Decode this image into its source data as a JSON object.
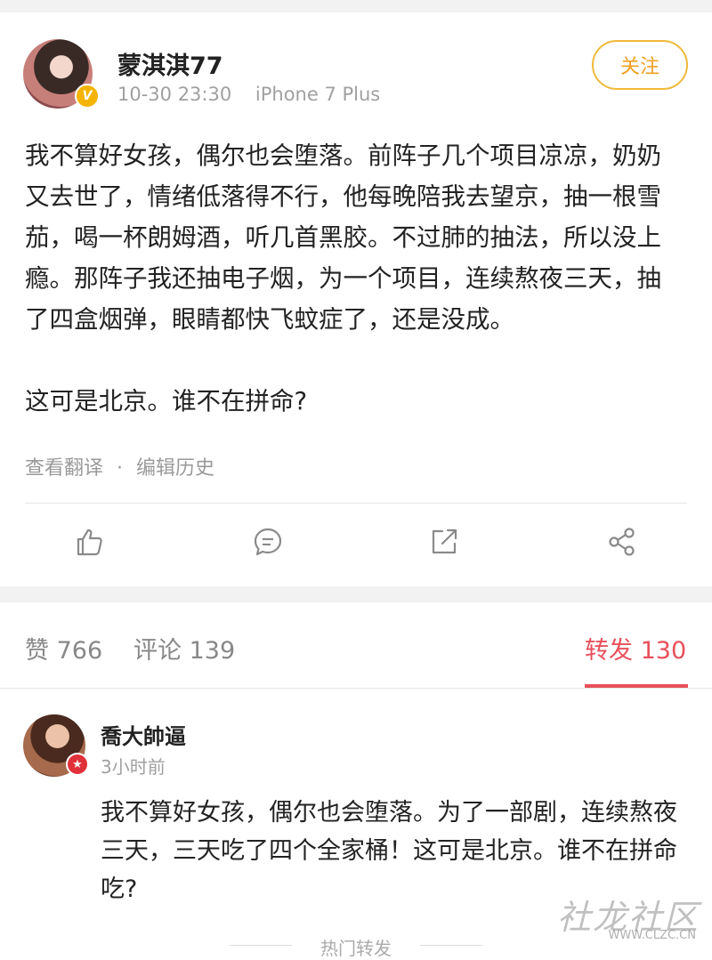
{
  "post": {
    "username": "蒙淇淇77",
    "verified_badge": "V",
    "time": "10-30 23:30",
    "device": "iPhone 7 Plus",
    "follow_label": "关注",
    "text": "我不算好女孩，偶尔也会堕落。前阵子几个项目凉凉，奶奶又去世了，情绪低落得不行，他每晚陪我去望京，抽一根雪茄，喝一杯朗姆酒，听几首黑胶。不过肺的抽法，所以没上瘾。那阵子我还抽电子烟，为一个项目，连续熬夜三天，抽了四盒烟弹，眼睛都快飞蚊症了，还是没成。\n\n这可是北京。谁不在拼命?",
    "translate_link": "查看翻译",
    "separator": "·",
    "edit_history_link": "编辑历史"
  },
  "actions": [
    "like-icon",
    "comment-icon",
    "repost-icon",
    "share-icon"
  ],
  "tabs": {
    "likes": "赞 766",
    "comments": "评论 139",
    "reposts": "转发 130"
  },
  "repost": {
    "username": "喬大帥逼",
    "time": "3小时前",
    "text": "我不算好女孩，偶尔也会堕落。为了一部剧，连续熬夜三天，三天吃了四个全家桶！这可是北京。谁不在拼命吃?"
  },
  "section_title": "热门转发",
  "watermark": {
    "main": "社龙社区",
    "sub": "WWW.CLZC.CN"
  },
  "colors": {
    "accent_red": "#e8505b",
    "follow_orange": "#f0b93a",
    "verified_gold": "#f5b400"
  }
}
